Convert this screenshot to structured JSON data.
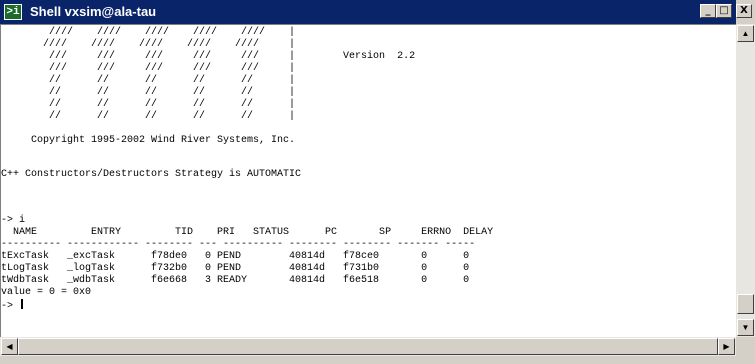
{
  "window": {
    "title": "Shell vxsim@ala-tau",
    "icon_glyph": ">i",
    "minimize_glyph": "_",
    "maximize_glyph": "□",
    "close_glyph": "X"
  },
  "console": {
    "lines": [
      "        ////    ////    ////    ////    ////    |",
      "       ////    ////    ////    ////    ////     |",
      "        ///     ///     ///     ///     ///     |        Version  2.2",
      "        ///     ///     ///     ///     ///     |",
      "        //      //      //      //      //      |",
      "        //      //      //      //      //      |",
      "        //      //      //      //      //      |",
      "        //      //      //      //      //      |",
      "",
      "     Copyright 1995-2002 Wind River Systems, Inc.",
      "",
      "C++ Constructors/Destructors Strategy is AUTOMATIC",
      "",
      "-> i",
      "  NAME         ENTRY         TID    PRI   STATUS      PC       SP     ERRNO  DELAY",
      "---------- ------------ -------- --- ---------- -------- -------- ------- -----",
      "tExcTask   _excTask      f78de0   0 PEND        40814d   f78ce0       0      0",
      "tLogTask   _logTask      f732b0   0 PEND        40814d   f731b0       0      0",
      "tWdbTask   _wdbTask      f6e668   3 READY       40814d   f6e518       0      0",
      "value = 0 = 0x0",
      "-> "
    ]
  },
  "scrollbar": {
    "up_glyph": "▲",
    "down_glyph": "▼",
    "left_glyph": "◀",
    "right_glyph": "▶"
  }
}
